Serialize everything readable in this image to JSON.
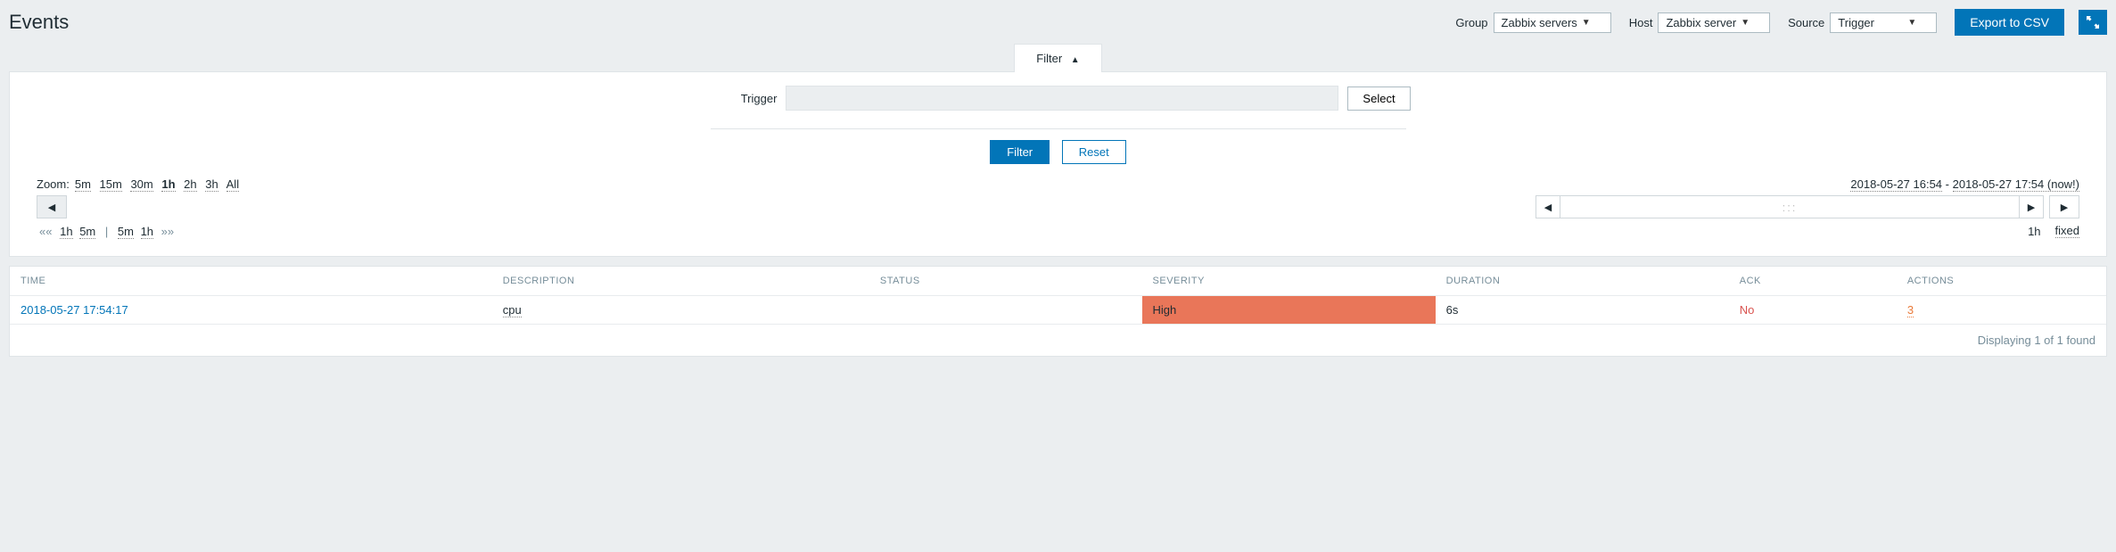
{
  "header": {
    "title": "Events",
    "group_label": "Group",
    "group_value": "Zabbix servers",
    "host_label": "Host",
    "host_value": "Zabbix server",
    "source_label": "Source",
    "source_value": "Trigger",
    "export_btn": "Export to CSV"
  },
  "filter": {
    "tab_label": "Filter",
    "trigger_label": "Trigger",
    "trigger_value": "",
    "select_btn": "Select",
    "filter_btn": "Filter",
    "reset_btn": "Reset"
  },
  "zoom": {
    "label": "Zoom:",
    "opts": [
      "5m",
      "15m",
      "30m",
      "1h",
      "2h",
      "3h",
      "All"
    ],
    "active": "1h",
    "range_from": "2018-05-27 16:54",
    "range_to": "2018-05-27 17:54 (now!)",
    "back_opts": [
      "1h",
      "5m"
    ],
    "fwd_opts": [
      "5m",
      "1h"
    ],
    "mode_time": "1h",
    "mode_fixed": "fixed"
  },
  "table": {
    "cols": {
      "time": "Time",
      "desc": "Description",
      "status": "Status",
      "severity": "Severity",
      "duration": "Duration",
      "ack": "Ack",
      "actions": "Actions"
    },
    "rows": [
      {
        "time": "2018-05-27 17:54:17",
        "desc": "cpu",
        "status": "",
        "severity": "High",
        "duration": "6s",
        "ack": "No",
        "actions": "3"
      }
    ],
    "footer": "Displaying 1 of 1 found"
  }
}
